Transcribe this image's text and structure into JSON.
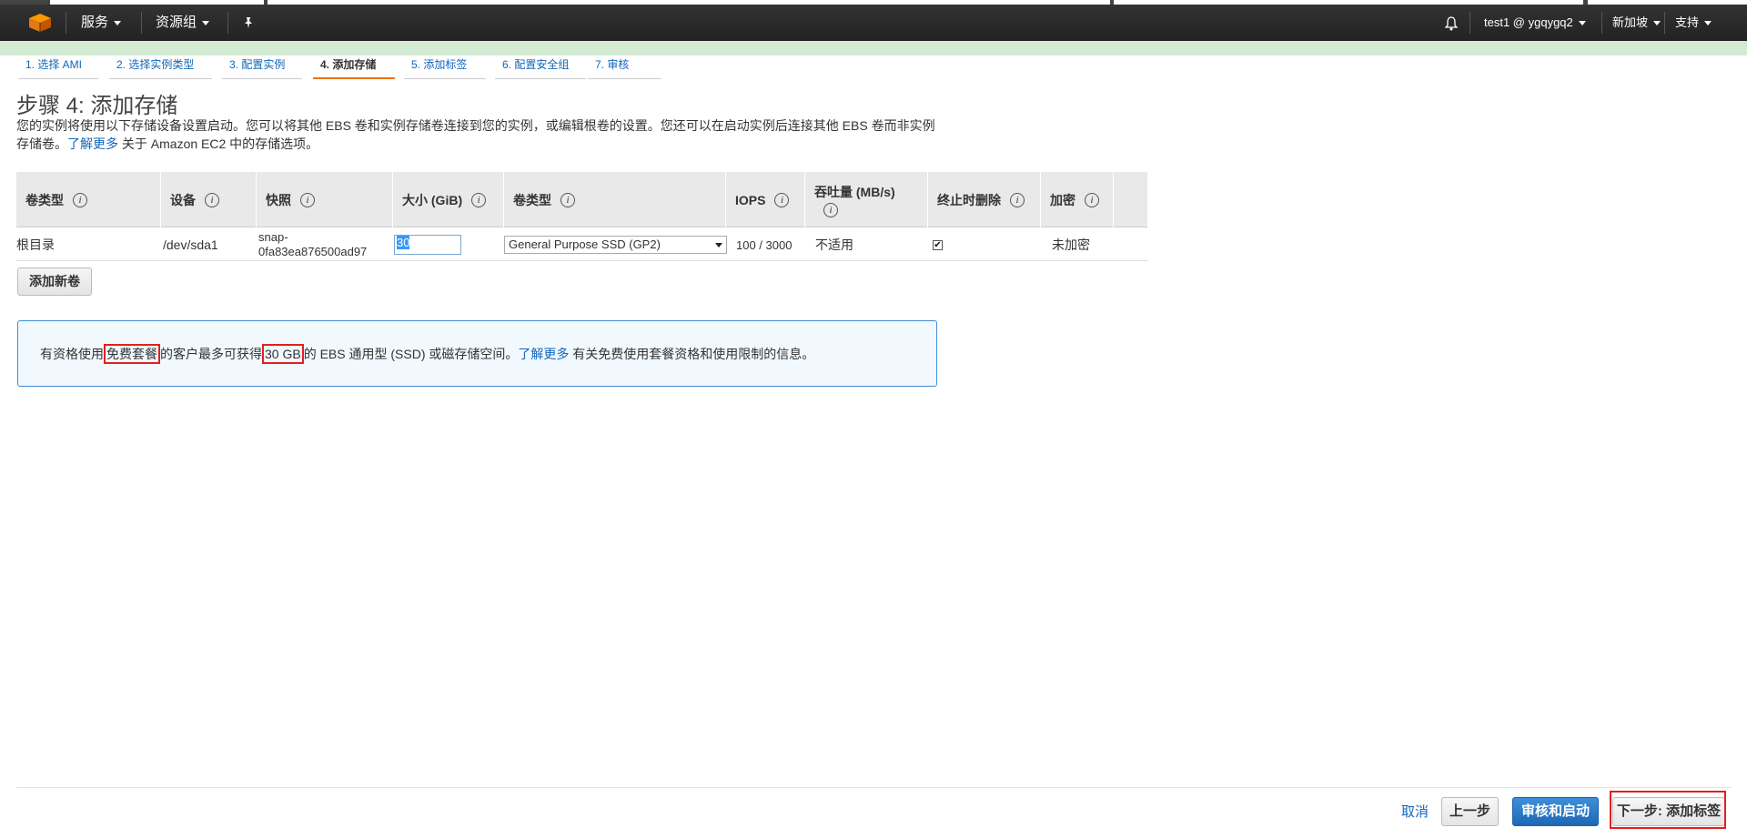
{
  "nav": {
    "services": "服务",
    "resource_groups": "资源组",
    "account": "test1 @ ygqygq2",
    "region": "新加坡",
    "support": "支持"
  },
  "tabs": [
    {
      "label": "1. 选择 AMI"
    },
    {
      "label": "2. 选择实例类型"
    },
    {
      "label": "3. 配置实例"
    },
    {
      "label": "4. 添加存储"
    },
    {
      "label": "5. 添加标签"
    },
    {
      "label": "6. 配置安全组"
    },
    {
      "label": "7. 审核"
    }
  ],
  "page": {
    "title": "步骤 4: 添加存储",
    "desc_line1": "您的实例将使用以下存储设备设置启动。您可以将其他 EBS 卷和实例存储卷连接到您的实例，或编辑根卷的设置。您还可以在启动实例后连接其他 EBS 卷而非实例",
    "desc_line2_pre": "存储卷。",
    "desc_link": "了解更多",
    "desc_line2_post": " 关于 Amazon EC2 中的存储选项。"
  },
  "table": {
    "headers": {
      "volume_type": "卷类型",
      "device": "设备",
      "snapshot": "快照",
      "size": "大小 (GiB)",
      "vol_kind": "卷类型",
      "iops": "IOPS",
      "throughput": "吞吐量 (MB/s)",
      "delete_on_term": "终止时删除",
      "encrypted": "加密"
    },
    "row": {
      "volume_type": "根目录",
      "device": "/dev/sda1",
      "snapshot_1": "snap-",
      "snapshot_2": "0fa83ea876500ad97",
      "size": "30",
      "vol_kind": "General Purpose SSD (GP2)",
      "iops": "100 / 3000",
      "throughput": "不适用",
      "delete_on_term": true,
      "encrypted": "未加密"
    }
  },
  "add_volume": "添加新卷",
  "info": {
    "t1": "有资格使用",
    "free_tier": "免费套餐",
    "t2": "的客户最多可获得",
    "amount": "30 GB",
    "t3": "的 EBS 通用型 (SSD) 或磁存储空间。",
    "link": "了解更多",
    "t4": " 有关免费使用套餐资格和使用限制的信息。"
  },
  "footer": {
    "cancel": "取消",
    "previous": "上一步",
    "review_launch": "审核和启动",
    "next": "下一步: 添加标签"
  },
  "colors": {
    "navbar": "#2b2b2b",
    "accent_tab": "#ec7211",
    "link": "#1166bb",
    "primary_button": "#1f67b5",
    "highlight_box": "#e02020"
  }
}
